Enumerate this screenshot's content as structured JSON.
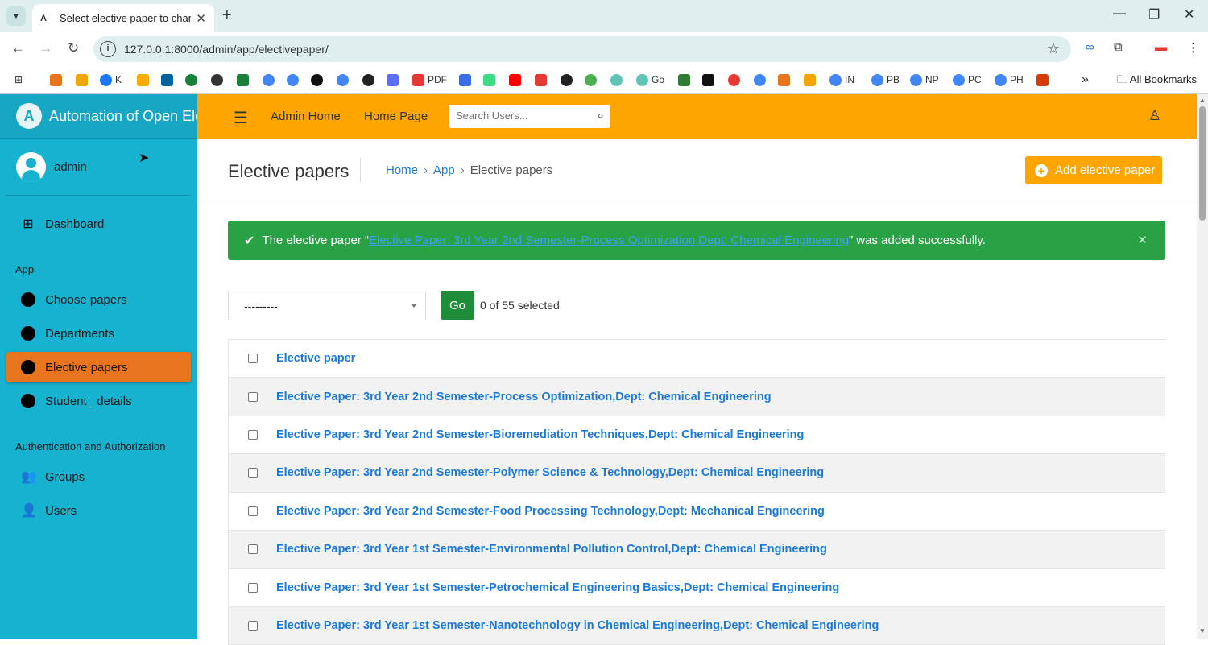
{
  "browser": {
    "tab_title": "Select elective paper to change",
    "tab_close": "✕",
    "new_tab": "+",
    "url": "127.0.0.1:8000/admin/app/electivepaper/",
    "all_bookmarks": "All Bookmarks",
    "bookmarks": [
      {
        "label": "K",
        "color": "#1877f2"
      },
      {
        "label": "PDF",
        "color": "#e53935"
      },
      {
        "label": "Go",
        "color": "#5ec4b6"
      },
      {
        "label": "IN",
        "color": "#4285f4"
      },
      {
        "label": "PB",
        "color": "#4285f4"
      },
      {
        "label": "NP",
        "color": "#4285f4"
      },
      {
        "label": "PC",
        "color": "#4285f4"
      },
      {
        "label": "PH",
        "color": "#4285f4"
      }
    ]
  },
  "sidebar": {
    "brand": "Automation of Open Elective",
    "brand_logo": "A",
    "user": "admin",
    "dashboard": "Dashboard",
    "section_app": "App",
    "app_items": [
      "Choose papers",
      "Departments",
      "Elective papers",
      "Student_ details"
    ],
    "active_item": "Elective papers",
    "section_auth": "Authentication and Authorization",
    "auth_items": [
      "Groups",
      "Users"
    ]
  },
  "topbar": {
    "admin_home": "Admin Home",
    "home_page": "Home Page",
    "search_placeholder": "Search Users..."
  },
  "page": {
    "title": "Elective papers",
    "breadcrumb": [
      "Home",
      "App",
      "Elective papers"
    ],
    "add_button": "Add elective paper"
  },
  "alert": {
    "prefix": "The elective paper “",
    "link": "Elective Paper: 3rd Year 2nd Semester-Process Optimization,Dept: Chemical Engineering",
    "suffix": "” was added successfully."
  },
  "actions": {
    "select_value": "---------",
    "go_label": "Go",
    "selected_count": "0 of 55 selected"
  },
  "table": {
    "header": "Elective paper",
    "rows": [
      "Elective Paper: 3rd Year 2nd Semester-Process Optimization,Dept: Chemical Engineering",
      "Elective Paper: 3rd Year 2nd Semester-Bioremediation Techniques,Dept: Chemical Engineering",
      "Elective Paper: 3rd Year 2nd Semester-Polymer Science & Technology,Dept: Chemical Engineering",
      "Elective Paper: 3rd Year 2nd Semester-Food Processing Technology,Dept: Mechanical Engineering",
      "Elective Paper: 3rd Year 1st Semester-Environmental Pollution Control,Dept: Chemical Engineering",
      "Elective Paper: 3rd Year 1st Semester-Petrochemical Engineering Basics,Dept: Chemical Engineering",
      "Elective Paper: 3rd Year 1st Semester-Nanotechnology in Chemical Engineering,Dept: Chemical Engineering"
    ]
  },
  "colors": {
    "sidebar": "#17b2d0",
    "topbar": "#ffa500",
    "active_nav": "#e8741e",
    "success": "#28a245",
    "link": "#1b7ad6",
    "go_button": "#1f8c3a"
  }
}
